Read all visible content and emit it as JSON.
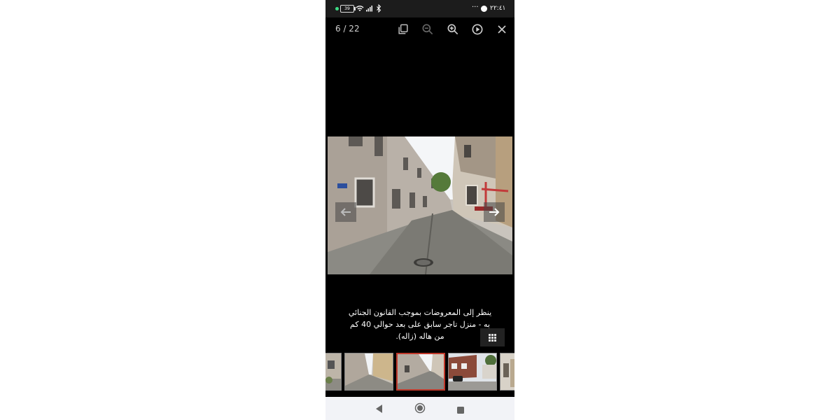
{
  "status_bar": {
    "battery": "39",
    "time": "٢٢:٤١",
    "icons": [
      "charging-dot-icon",
      "battery-icon",
      "wifi-icon",
      "signal-icon",
      "bluetooth-icon",
      "more-icon",
      "facebook-icon"
    ]
  },
  "viewer": {
    "counter": "6 / 22",
    "toolbar": [
      "copy-icon",
      "zoom-out-icon",
      "zoom-in-icon",
      "slideshow-icon",
      "close-icon"
    ],
    "caption": "ينظر إلى المعروضات بموجب القانون الجنائي به - منزل تاجر سابق على بعد حوالي 40 كم من هاله (زاله).",
    "thumbnails": [
      {
        "label": "thumb-1",
        "active": false
      },
      {
        "label": "thumb-2",
        "active": false
      },
      {
        "label": "thumb-3",
        "active": true
      },
      {
        "label": "thumb-4",
        "active": false
      },
      {
        "label": "thumb-5",
        "active": false
      }
    ]
  },
  "colors": {
    "accent": "#c0392b",
    "status_bg": "#1c1c1c",
    "nav_bg": "#f2f3f7",
    "charging": "#3ddc84"
  },
  "system_nav": [
    "back-icon",
    "home-icon",
    "recents-icon"
  ]
}
